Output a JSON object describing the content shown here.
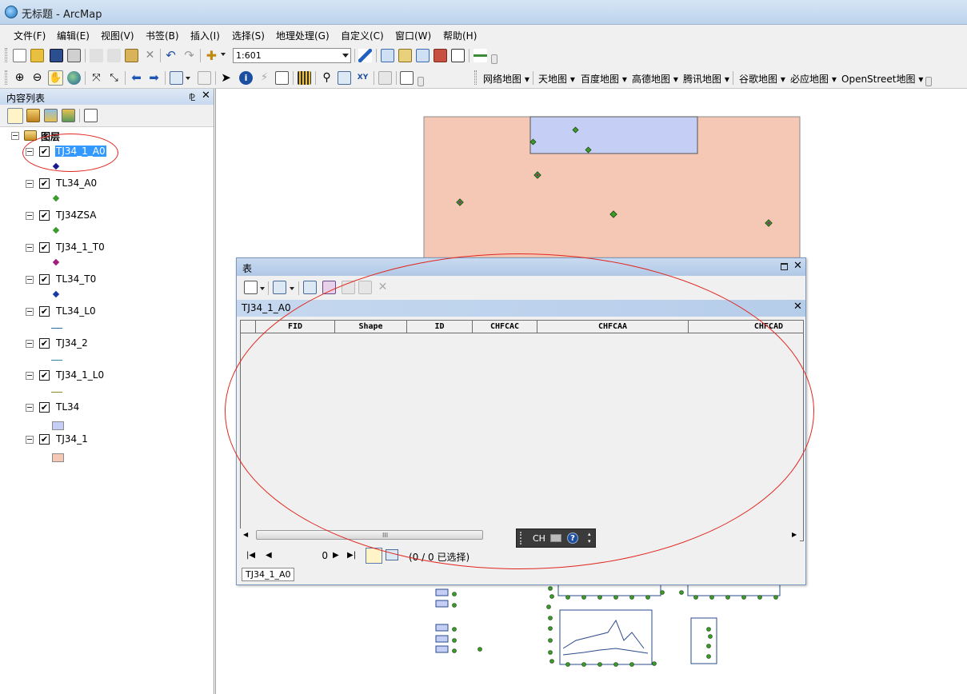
{
  "window": {
    "title": "无标题 - ArcMap"
  },
  "menu": [
    "文件(F)",
    "编辑(E)",
    "视图(V)",
    "书签(B)",
    "插入(I)",
    "选择(S)",
    "地理处理(G)",
    "自定义(C)",
    "窗口(W)",
    "帮助(H)"
  ],
  "toolbar": {
    "scale": "1:601",
    "map_services": [
      "网络地图",
      "天地图",
      "百度地图",
      "高德地图",
      "腾讯地图",
      "谷歌地图",
      "必应地图",
      "OpenStreet地图"
    ]
  },
  "toc": {
    "title": "内容列表",
    "pin_icon": "⅊",
    "close_icon": "✕",
    "root": "图层",
    "layers": [
      {
        "name": "TJ34_1_A0",
        "symbol": "point",
        "color": "#1a1a8c",
        "selected": true
      },
      {
        "name": "TL34_A0",
        "symbol": "point",
        "color": "#3a9a2a"
      },
      {
        "name": "TJ34ZSA",
        "symbol": "point",
        "color": "#3a9a2a"
      },
      {
        "name": "TJ34_1_T0",
        "symbol": "point",
        "color": "#a0207a"
      },
      {
        "name": "TL34_T0",
        "symbol": "point",
        "color": "#1a3aa0"
      },
      {
        "name": "TL34_L0",
        "symbol": "line",
        "color": "#2a6aa0"
      },
      {
        "name": "TJ34_2",
        "symbol": "line",
        "color": "#2a8a9a"
      },
      {
        "name": "TJ34_1_L0",
        "symbol": "line",
        "color": "#8a8a20"
      },
      {
        "name": "TL34",
        "symbol": "polygon",
        "color": "#c5cff5"
      },
      {
        "name": "TJ34_1",
        "symbol": "polygon",
        "color": "#f5c8b5"
      }
    ]
  },
  "table_window": {
    "title": "表",
    "tab": "TJ34_1_A0",
    "columns": [
      {
        "label": "",
        "w": 18
      },
      {
        "label": "FID",
        "w": 99
      },
      {
        "label": "Shape",
        "w": 90
      },
      {
        "label": "ID",
        "w": 82
      },
      {
        "label": "CHFCAC",
        "w": 81
      },
      {
        "label": "CHFCAA",
        "w": 189
      },
      {
        "label": "CHFCAD",
        "w": 194
      }
    ],
    "record": "0",
    "selection_status": "(0 / 0 已选择)",
    "bottom_tab": "TJ34_1_A0",
    "scroll_grip": "III"
  },
  "ime": {
    "label": "CH"
  },
  "colors": {
    "polygon_salmon": "#f5c8b5",
    "polygon_blue": "#c5cff5",
    "annotation": "#e0261e"
  }
}
